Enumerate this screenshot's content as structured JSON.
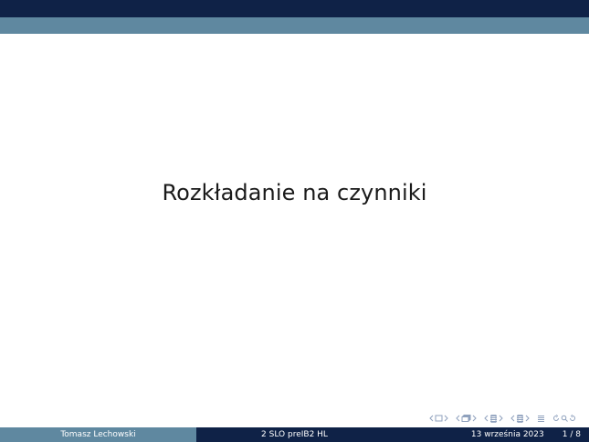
{
  "slide": {
    "title": "Rozkładanie na czynniki"
  },
  "footer": {
    "author": "Tomasz Lechowski",
    "presentation_title": "2 SLO preIB2 HL",
    "date": "13 września 2023",
    "page_current": "1",
    "page_separator": "/",
    "page_total": "8"
  },
  "navigation": {
    "icons": [
      "slide-prev-arrow-icon",
      "slide-icon",
      "slide-next-arrow-icon",
      "frame-prev-arrow-icon",
      "frame-icon",
      "frame-next-arrow-icon",
      "subsection-prev-arrow-icon",
      "subsection-icon",
      "subsection-next-arrow-icon",
      "section-prev-arrow-icon",
      "section-icon",
      "section-next-arrow-icon",
      "document-icon",
      "search-back-icon",
      "search-icon",
      "search-forward-icon"
    ]
  },
  "colors": {
    "dark_band": "#0f2247",
    "light_band": "#5f88a0",
    "nav_icons": "#8fa1bd",
    "title_text": "#1a1a1a"
  }
}
